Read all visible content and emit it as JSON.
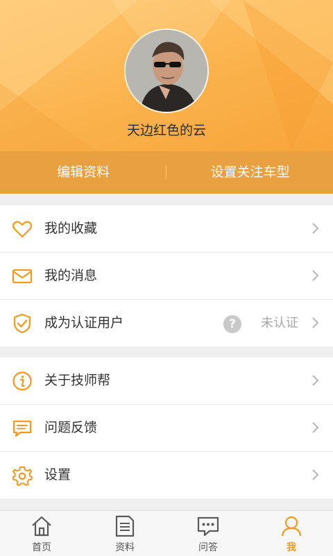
{
  "profile": {
    "username": "天边红色的云"
  },
  "actions": {
    "edit": "编辑资料",
    "cars": "设置关注车型"
  },
  "menu_group_1": [
    {
      "label": "我的收藏",
      "icon": "heart-icon"
    },
    {
      "label": "我的消息",
      "icon": "envelope-icon"
    },
    {
      "label": "成为认证用户",
      "icon": "shield-check-icon",
      "status": "未认证",
      "status_icon": "question-icon"
    }
  ],
  "menu_group_2": [
    {
      "label": "关于技师帮",
      "icon": "info-icon"
    },
    {
      "label": "问题反馈",
      "icon": "feedback-icon"
    },
    {
      "label": "设置",
      "icon": "gear-icon"
    }
  ],
  "status_help_glyph": "?",
  "tabs": [
    {
      "label": "首页",
      "icon": "home-icon",
      "active": false
    },
    {
      "label": "资料",
      "icon": "document-icon",
      "active": false
    },
    {
      "label": "问答",
      "icon": "chat-icon",
      "active": false
    },
    {
      "label": "我",
      "icon": "user-icon",
      "active": true
    }
  ],
  "colors": {
    "accent": "#f39a1c",
    "header_bar": "#e9a040",
    "header_gradient_start": "#ffc870",
    "header_gradient_end": "#f7a53a"
  }
}
